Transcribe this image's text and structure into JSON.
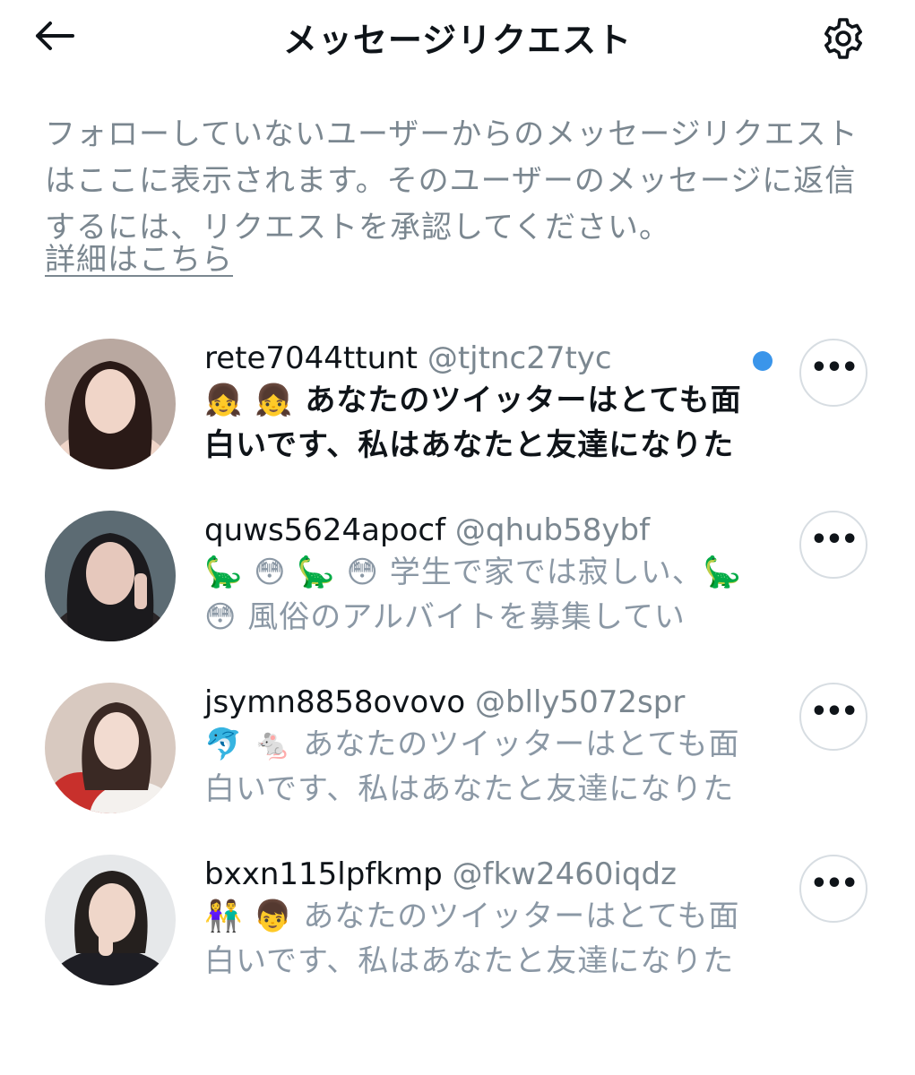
{
  "header": {
    "title": "メッセージリクエスト"
  },
  "intro": {
    "text": "フォローしていないユーザーからのメッセージリクエストはここに表示されます。そのユーザーのメッセージに返信するには、リクエストを承認してください。",
    "learn_more": "詳細はこちら"
  },
  "requests": [
    {
      "display_name": "rete7044ttunt",
      "handle": "@tjtnc27tyc",
      "preview": "👧 👧 あなたのツイッターはとても面白いです、私はあなたと友達になりた",
      "unread": true,
      "more_label": "•••",
      "avatar_colors": [
        "#b9a8a0",
        "#2a1a17",
        "#f0d5c8"
      ]
    },
    {
      "display_name": "quws5624apocf",
      "handle": "@qhub58ybf",
      "preview": "🦕 😳 🦕 😳 学生で家では寂しい、🦕 😳 風俗のアルバイトを募集してい",
      "unread": false,
      "more_label": "•••",
      "avatar_colors": [
        "#5c6b73",
        "#1b1a1d",
        "#e6c8bc"
      ]
    },
    {
      "display_name": "jsymn8858ovovo",
      "handle": "@blly5072spr",
      "preview": "🐬 🐁 あなたのツイッターはとても面白いです、私はあなたと友達になりた",
      "unread": false,
      "more_label": "•••",
      "avatar_colors": [
        "#d8c9c0",
        "#3a2924",
        "#f2dbd0"
      ]
    },
    {
      "display_name": "bxxn115lpfkmp",
      "handle": "@fkw2460iqdz",
      "preview": "👫 👦 あなたのツイッターはとても面白いです、私はあなたと友達になりた",
      "unread": false,
      "more_label": "•••",
      "avatar_colors": [
        "#e6e8ea",
        "#25201e",
        "#efd6c9"
      ]
    }
  ]
}
